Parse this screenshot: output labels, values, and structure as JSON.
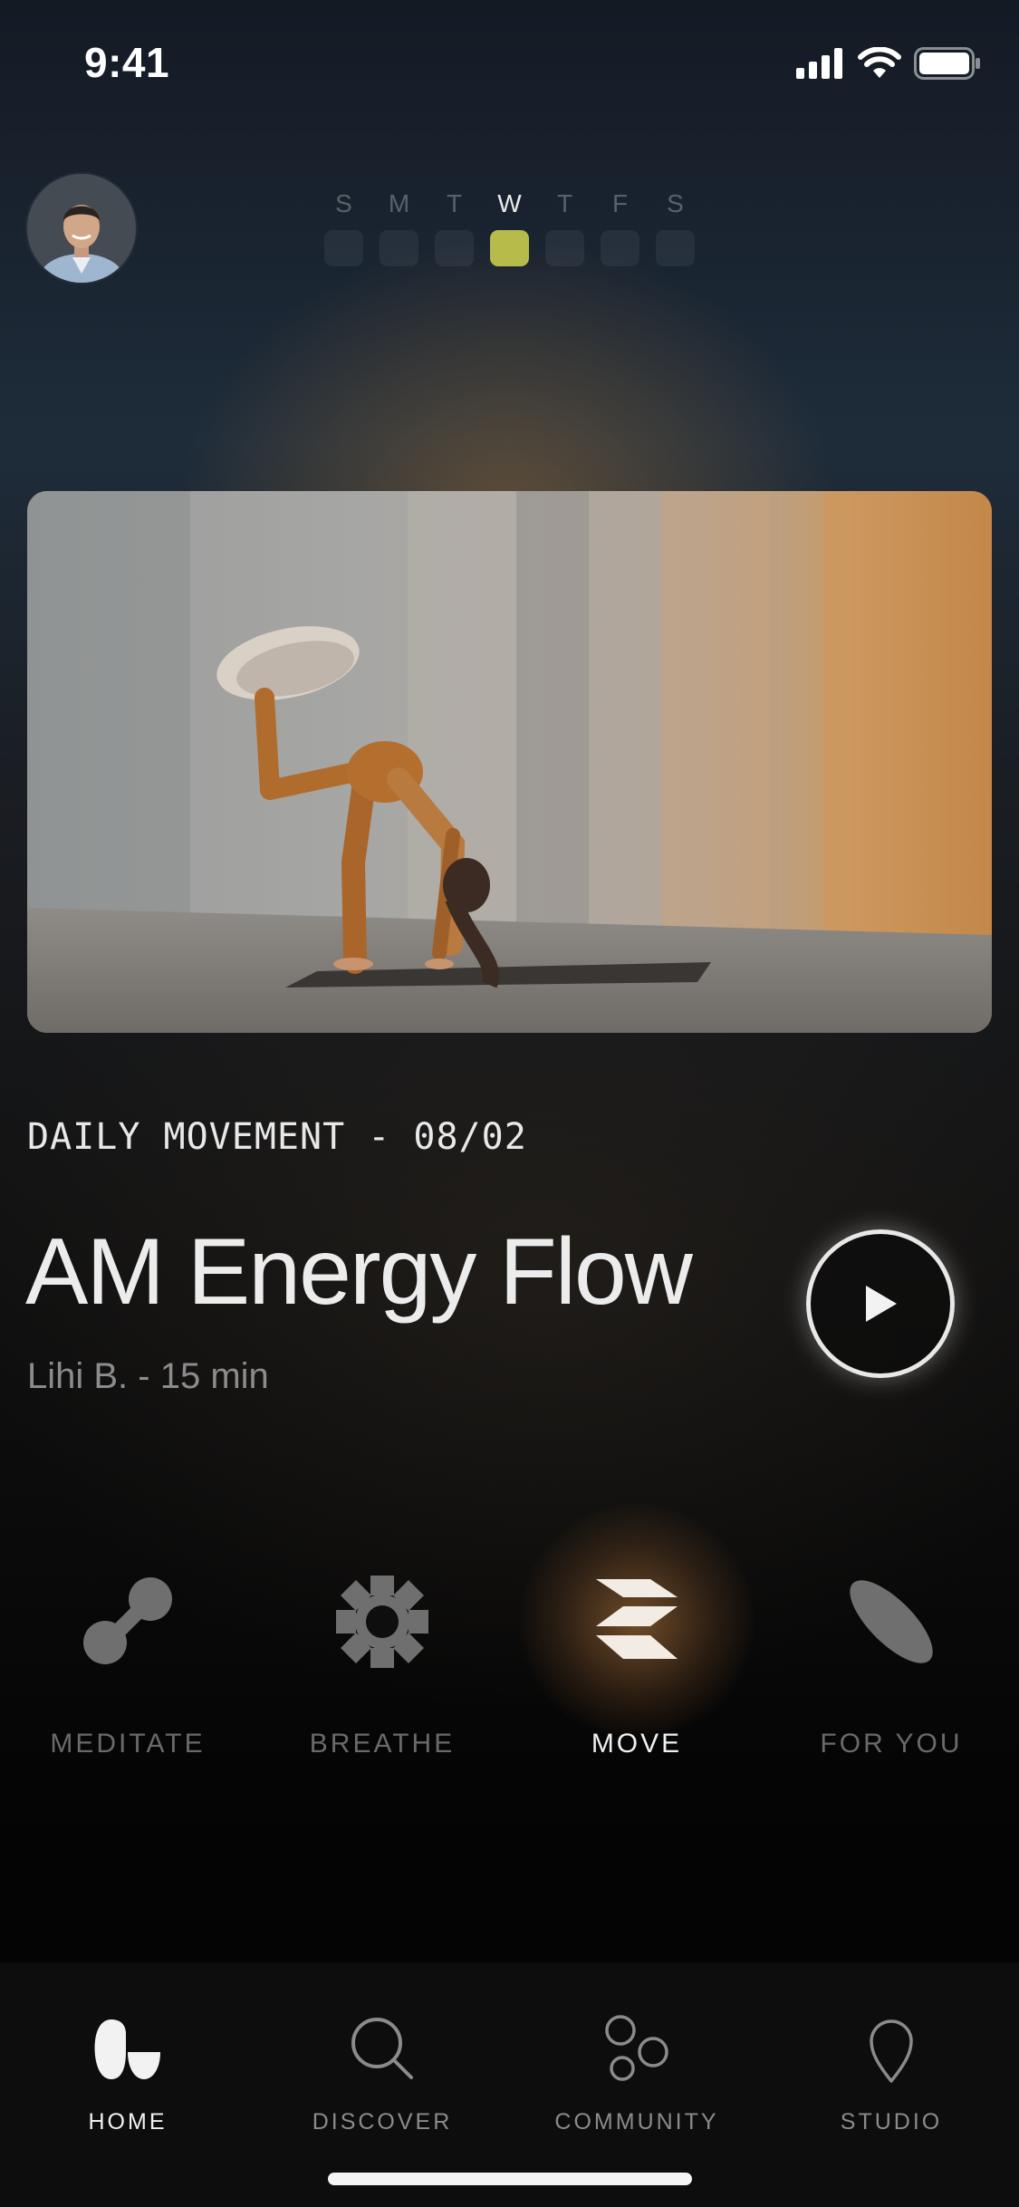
{
  "status_bar": {
    "time": "9:41"
  },
  "week": {
    "days": [
      {
        "letter": "S",
        "active": false
      },
      {
        "letter": "M",
        "active": false
      },
      {
        "letter": "T",
        "active": false
      },
      {
        "letter": "W",
        "active": true
      },
      {
        "letter": "T",
        "active": false
      },
      {
        "letter": "F",
        "active": false
      },
      {
        "letter": "S",
        "active": false
      }
    ],
    "accent_color": "#b7bb4a"
  },
  "featured": {
    "eyebrow": "DAILY MOVEMENT - 08/02",
    "title": "AM Energy Flow",
    "subtitle": "Lihi B. - 15 min"
  },
  "categories": [
    {
      "label": "MEDITATE",
      "icon": "meditate-icon",
      "active": false
    },
    {
      "label": "BREATHE",
      "icon": "breathe-icon",
      "active": false
    },
    {
      "label": "MOVE",
      "icon": "move-icon",
      "active": true
    },
    {
      "label": "FOR YOU",
      "icon": "for-you-icon",
      "active": false
    }
  ],
  "tabs": [
    {
      "label": "HOME",
      "icon": "home-icon",
      "active": true
    },
    {
      "label": "DISCOVER",
      "icon": "search-icon",
      "active": false
    },
    {
      "label": "COMMUNITY",
      "icon": "community-icon",
      "active": false
    },
    {
      "label": "STUDIO",
      "icon": "location-pin-icon",
      "active": false
    }
  ]
}
